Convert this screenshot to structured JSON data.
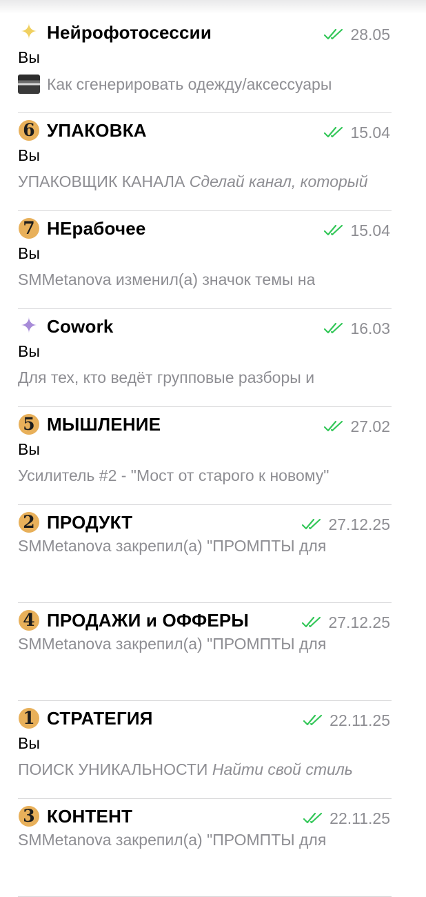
{
  "chats": [
    {
      "icon": "sparkles-icon",
      "icon_symbol": "✦",
      "icon_color": "#f0d060",
      "title": "Нейрофотосессии",
      "date": "28.05",
      "sender": "Вы",
      "preview": "Как сгенерировать одежду/аксессуары",
      "preview_italic": "",
      "has_thumbnail": true
    },
    {
      "icon": "number-6-icon",
      "icon_symbol": "6",
      "title": "УПАКОВКА",
      "date": "15.04",
      "sender": "Вы",
      "preview": "УПАКОВЩИК КАНАЛА ",
      "preview_italic": "Сделай канал, который",
      "has_thumbnail": false
    },
    {
      "icon": "number-7-icon",
      "icon_symbol": "7",
      "title": "НЕрабочее",
      "date": "15.04",
      "sender": "Вы",
      "preview": "SMMetanova изменил(а) значок темы на",
      "preview_italic": "",
      "has_thumbnail": false
    },
    {
      "icon": "purple-sparkle-icon",
      "icon_symbol": "✦",
      "icon_color": "#a78bd8",
      "title": "Cowork",
      "date": "16.03",
      "sender": "Вы",
      "preview": "Для тех, кто ведёт групповые разборы и",
      "preview_italic": "",
      "has_thumbnail": false
    },
    {
      "icon": "number-5-icon",
      "icon_symbol": "5",
      "title": "МЫШЛЕНИЕ",
      "date": "27.02",
      "sender": "Вы",
      "preview": "Усилитель #2 - \"Мост от старого к новому\"",
      "preview_italic": "",
      "has_thumbnail": false
    },
    {
      "icon": "number-2-icon",
      "icon_symbol": "2",
      "title": "ПРОДУКТ",
      "date": "27.12.25",
      "sender": "",
      "preview": "SMMetanova закрепил(а) \"ПРОМПТЫ для",
      "preview_italic": "",
      "has_thumbnail": false
    },
    {
      "icon": "number-4-icon",
      "icon_symbol": "4",
      "title": "ПРОДАЖИ и ОФФЕРЫ",
      "date": "27.12.25",
      "sender": "",
      "preview": "SMMetanova закрепил(а) \"ПРОМПТЫ для",
      "preview_italic": "",
      "has_thumbnail": false
    },
    {
      "icon": "number-1-icon",
      "icon_symbol": "1",
      "title": "СТРАТЕГИЯ",
      "date": "22.11.25",
      "sender": "Вы",
      "preview": "ПОИСК УНИКАЛЬНОСТИ ",
      "preview_italic": "Найти свой стиль",
      "has_thumbnail": false
    },
    {
      "icon": "number-3-icon",
      "icon_symbol": "3",
      "title": "КОНТЕНТ",
      "date": "22.11.25",
      "sender": "",
      "preview": "SMMetanova закрепил(а) \"ПРОМПТЫ для",
      "preview_italic": "",
      "has_thumbnail": false
    }
  ],
  "colors": {
    "read_check": "#34c759",
    "number_badge": "#e8b05a",
    "muted_text": "#8e8e93"
  }
}
